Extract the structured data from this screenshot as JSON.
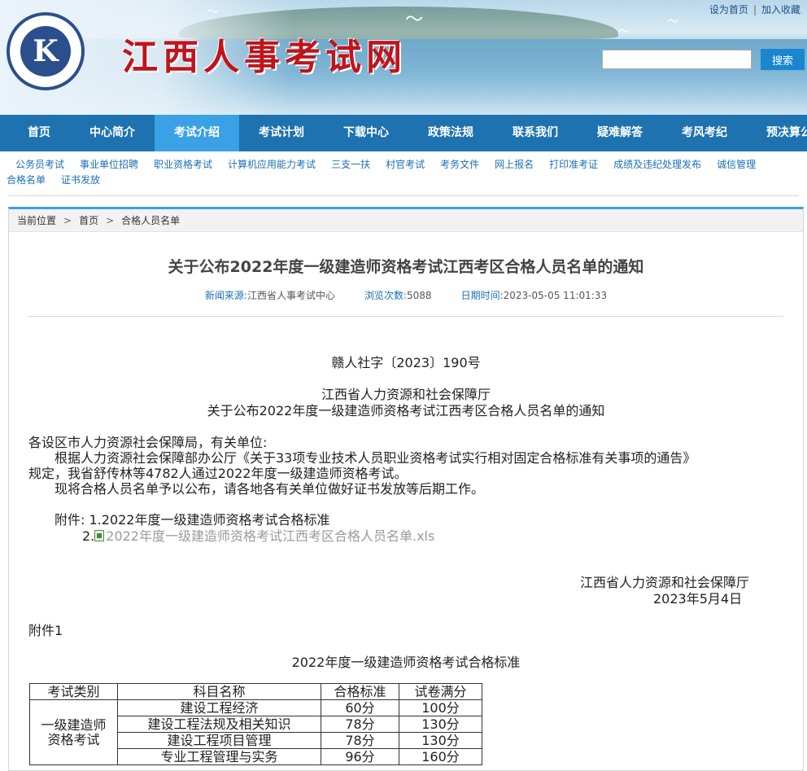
{
  "header": {
    "site_title": "江西人事考试网",
    "logo_text": "Personnel Testing Center of Jiangxi Province",
    "top_links": [
      "设为首页",
      "加入收藏"
    ],
    "search_button": "搜索",
    "search_placeholder": ""
  },
  "main_nav": [
    {
      "label": "首页",
      "active": false
    },
    {
      "label": "中心简介",
      "active": false
    },
    {
      "label": "考试介绍",
      "active": true
    },
    {
      "label": "考试计划",
      "active": false
    },
    {
      "label": "下载中心",
      "active": false
    },
    {
      "label": "政策法规",
      "active": false
    },
    {
      "label": "联系我们",
      "active": false
    },
    {
      "label": "疑难解答",
      "active": false
    },
    {
      "label": "考风考纪",
      "active": false
    },
    {
      "label": "预决算公开",
      "active": false
    }
  ],
  "sub_nav": [
    "公务员考试",
    "事业单位招聘",
    "职业资格考试",
    "计算机应用能力考试",
    "三支一扶",
    "村官考试",
    "考务文件",
    "网上报名",
    "打印准考证",
    "成绩及违纪处理发布",
    "诚信管理",
    "合格名单",
    "证书发放"
  ],
  "breadcrumb": {
    "prefix": "当前位置",
    "items": [
      "首页",
      "合格人员名单"
    ]
  },
  "article": {
    "title": "关于公布2022年度一级建造师资格考试江西考区合格人员名单的通知",
    "meta": {
      "source_label": "新闻来源:",
      "source": "江西省人事考试中心",
      "views_label": "浏览次数:",
      "views": "5088",
      "date_label": "日期时间:",
      "date": "2023-05-05 11:01:33"
    },
    "doc_number": "赣人社字〔2023〕190号",
    "issuer": "江西省人力资源和社会保障厅",
    "doc_title": "关于公布2022年度一级建造师资格考试江西考区合格人员名单的通知",
    "salutation": "各设区市人力资源社会保障局，有关单位:",
    "para1_line1": "根据人力资源社会保障部办公厅《关于33项专业技术人员职业资格考试实行相对固定合格标准有关事项的通告》",
    "para1_line2": "规定，我省舒传林等4782人通过2022年度一级建造师资格考试。",
    "para2": "现将合格人员名单予以公布，请各地各有关单位做好证书发放等后期工作。",
    "attach_label": "附件:",
    "attach1": "1.2022年度一级建造师资格考试合格标准",
    "attach2_num": "2.",
    "attach2": "2022年度一级建造师资格考试江西考区合格人员名单.xls",
    "sign_org": "江西省人力资源和社会保障厅",
    "sign_date": "2023年5月4日",
    "appendix_label": "附件1",
    "table_title": "2022年度一级建造师资格考试合格标准",
    "table": {
      "headers": [
        "考试类别",
        "科目名称",
        "合格标准",
        "试卷满分"
      ],
      "category_line1": "一级建造师",
      "category_line2": "资格考试",
      "rows": [
        [
          "建设工程经济",
          "60分",
          "100分"
        ],
        [
          "建设工程法规及相关知识",
          "78分",
          "130分"
        ],
        [
          "建设工程项目管理",
          "78分",
          "130分"
        ],
        [
          "专业工程管理与实务",
          "96分",
          "160分"
        ]
      ]
    }
  }
}
